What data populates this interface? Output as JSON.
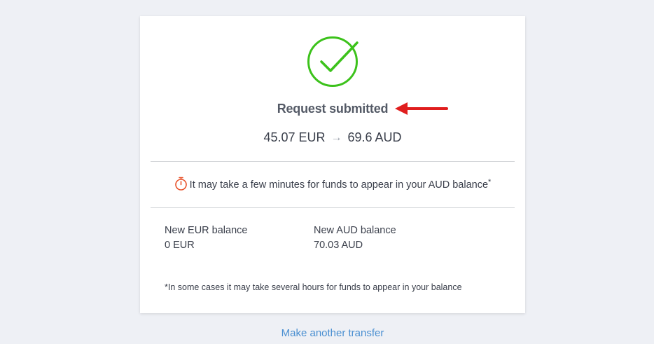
{
  "card": {
    "status_title": "Request submitted",
    "conversion": {
      "from_amount": "45.07 EUR",
      "arrow": "→",
      "to_amount": "69.6 AUD"
    },
    "notice": {
      "text": "It may take a few minutes for funds to appear in your AUD balance",
      "marker": "*"
    },
    "balances": [
      {
        "label": "New EUR balance",
        "value": "0 EUR"
      },
      {
        "label": "New AUD balance",
        "value": "70.03 AUD"
      }
    ],
    "footnote": "*In some cases it may take several hours for funds to appear in your balance"
  },
  "actions": {
    "make_another_transfer": "Make another transfer"
  },
  "colors": {
    "success_green": "#3cc21b",
    "annotation_red": "#e01e1e",
    "link_blue": "#4a8fd1",
    "timer_orange": "#e8522a"
  },
  "icons": {
    "status": "check-circle-icon",
    "notice": "stopwatch-icon",
    "annotation": "red-arrow-icon"
  }
}
